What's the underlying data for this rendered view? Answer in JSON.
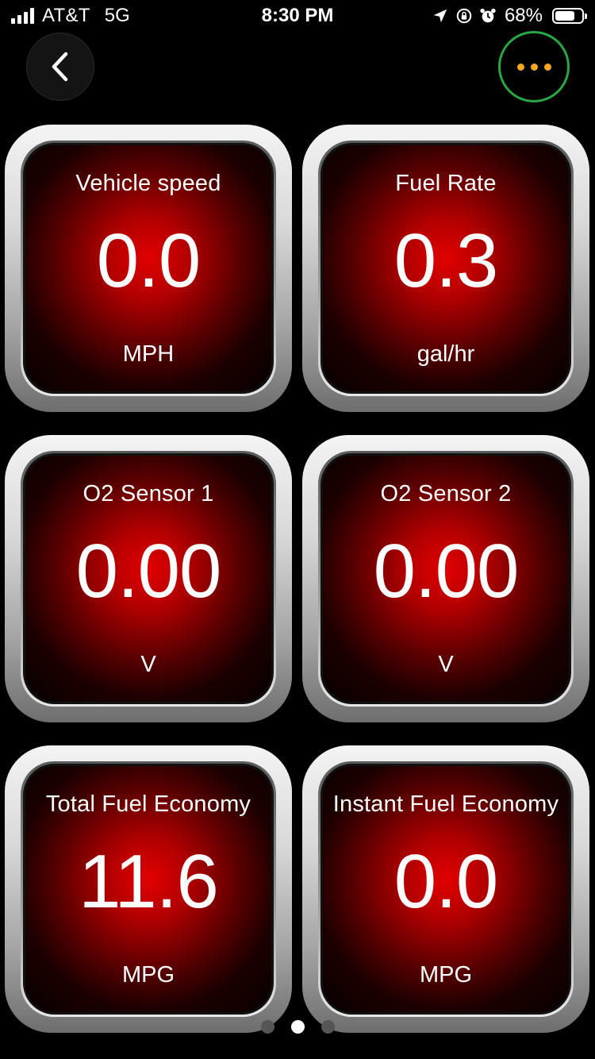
{
  "status_bar": {
    "carrier": "AT&T",
    "network": "5G",
    "time": "8:30 PM",
    "battery_percent": "68%",
    "icons": [
      "signal-icon",
      "location-icon",
      "rotation-lock-icon",
      "alarm-icon",
      "battery-icon"
    ]
  },
  "header": {
    "back_icon": "chevron-left-icon",
    "more_icon": "more-dots-icon",
    "more_ring_color": "#28a745",
    "more_dots_color": "#f5a623"
  },
  "gauges": [
    {
      "title": "Vehicle speed",
      "value": "0.0",
      "unit": "MPH"
    },
    {
      "title": "Fuel Rate",
      "value": "0.3",
      "unit": "gal/hr"
    },
    {
      "title": "O2 Sensor 1",
      "value": "0.00",
      "unit": "V"
    },
    {
      "title": "O2 Sensor 2",
      "value": "0.00",
      "unit": "V"
    },
    {
      "title": "Total Fuel Economy",
      "value": "11.6",
      "unit": "MPG"
    },
    {
      "title": "Instant Fuel Economy",
      "value": "0.0",
      "unit": "MPG"
    }
  ],
  "pagination": {
    "page_count": 3,
    "current_page": 2
  },
  "colors": {
    "gauge_face": "#e10000",
    "background": "#000000"
  }
}
